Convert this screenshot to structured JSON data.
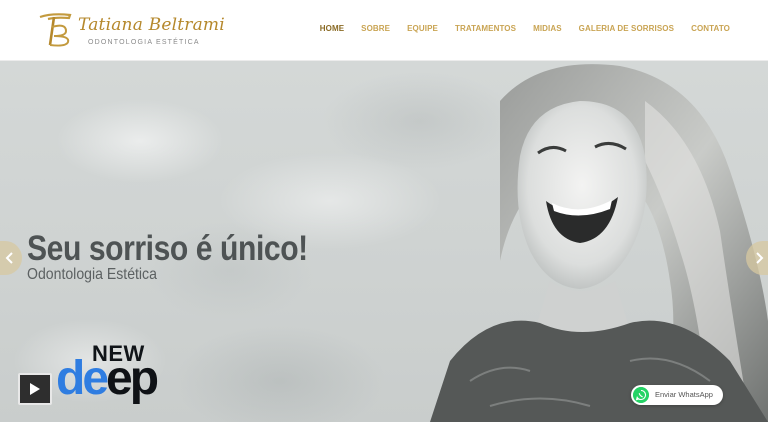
{
  "logo": {
    "name": "Tatiana Beltrami",
    "subtitle": "ODONTOLOGIA ESTÉTICA"
  },
  "nav": {
    "items": [
      {
        "label": "HOME",
        "active": true
      },
      {
        "label": "SOBRE"
      },
      {
        "label": "EQUIPE"
      },
      {
        "label": "TRATAMENTOS"
      },
      {
        "label": "MIDIAS"
      },
      {
        "label": "GALERIA DE SORRISOS"
      },
      {
        "label": "CONTATO"
      }
    ]
  },
  "hero": {
    "headline": "Seu sorriso é único!",
    "subline": "Odontologia Estética"
  },
  "watermark": {
    "top": "NEW",
    "part1": "de",
    "part2": "ep"
  },
  "whatsapp": {
    "label": "Enviar WhatsApp"
  },
  "colors": {
    "gold": "#c9a453",
    "gold_active": "#8a6a24",
    "headline": "#4e5354",
    "whatsapp": "#25d366",
    "brand_blue": "#2f7de1"
  },
  "icons": [
    "monogram-logo-icon",
    "chevron-left-icon",
    "chevron-right-icon",
    "play-icon",
    "whatsapp-icon"
  ]
}
